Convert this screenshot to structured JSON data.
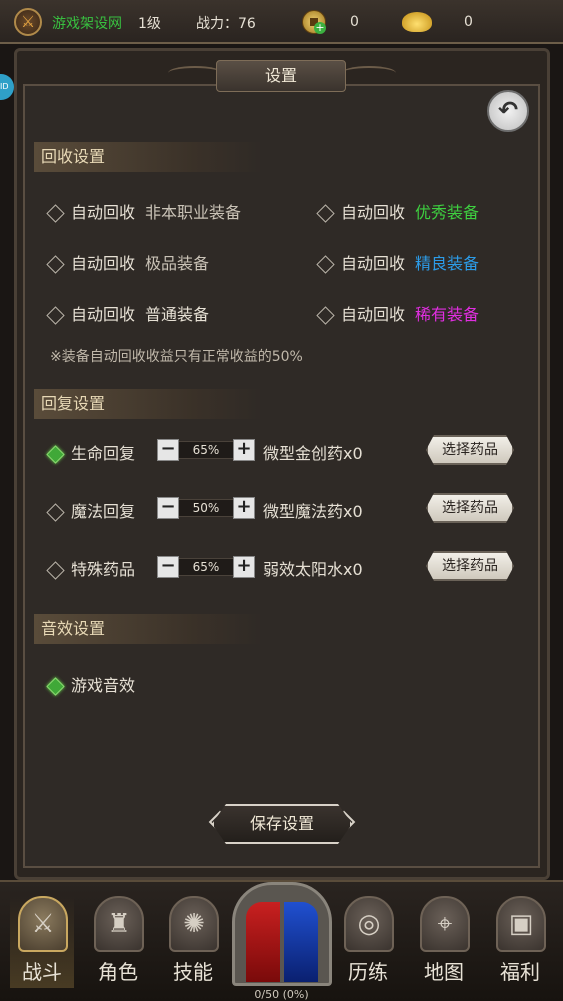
{
  "topbar": {
    "player_name": "游戏架设网",
    "level": "1级",
    "power_label": "战力：76",
    "coin_value": "0",
    "ingot_value": "0"
  },
  "dialog": {
    "title": "设置",
    "side_badge": "ID"
  },
  "recycle": {
    "header": "回收设置",
    "prefix": "自动回收",
    "items": [
      {
        "label": "非本职业装备",
        "color": "#c9c2b6"
      },
      {
        "label": "优秀装备",
        "color": "#3ed040"
      },
      {
        "label": "极品装备",
        "color": "#c9c2b6"
      },
      {
        "label": "精良装备",
        "color": "#2c9ce8"
      },
      {
        "label": "普通装备",
        "color": "#e6e0d4"
      },
      {
        "label": "稀有装备",
        "color": "#e02ee0"
      }
    ],
    "note": "※装备自动回收收益只有正常收益的50%"
  },
  "recover": {
    "header": "回复设置",
    "pick_label": "选择药品",
    "rows": [
      {
        "label": "生命回复",
        "checked": true,
        "percent": "65%",
        "potion": "微型金创药x0"
      },
      {
        "label": "魔法回复",
        "checked": false,
        "percent": "50%",
        "potion": "微型魔法药x0"
      },
      {
        "label": "特殊药品",
        "checked": false,
        "percent": "65%",
        "potion": "弱效太阳水x0"
      }
    ]
  },
  "sound": {
    "header": "音效设置",
    "label": "游戏音效",
    "checked": true
  },
  "save_label": "保存设置",
  "nav": {
    "items": [
      {
        "label": "战斗",
        "icon": "crossed-swords-icon",
        "active": true
      },
      {
        "label": "角色",
        "icon": "helmet-icon",
        "active": false
      },
      {
        "label": "技能",
        "icon": "skill-flame-icon",
        "active": false
      },
      {
        "label": "历练",
        "icon": "vortex-icon",
        "active": false
      },
      {
        "label": "地图",
        "icon": "map-pin-icon",
        "active": false
      },
      {
        "label": "福利",
        "icon": "treasure-chest-icon",
        "active": false
      }
    ],
    "exp": "0/50 (0%)"
  }
}
